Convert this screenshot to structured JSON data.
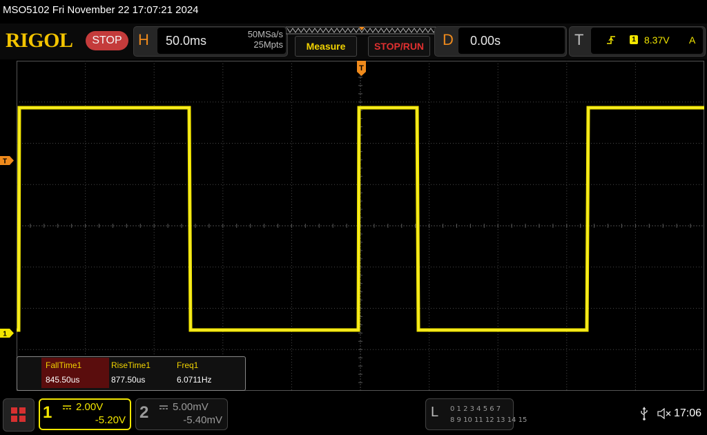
{
  "title_bar": {
    "text": "MSO5102  Fri November 22 17:07:21 2024"
  },
  "toolbar": {
    "logo": "RIGOL",
    "run_state": "STOP",
    "horizontal": {
      "letter": "H",
      "timebase": "50.0ms",
      "sample_rate": "50MSa/s",
      "memory_depth": "25Mpts"
    },
    "measure_label": "Measure",
    "stoprun_label": "STOP/RUN",
    "delay": {
      "letter": "D",
      "value": "0.00s"
    },
    "trigger": {
      "letter": "T",
      "edge_icon": "rising-edge-icon",
      "source": "1",
      "level": "8.37V",
      "mode": "A"
    }
  },
  "markers": {
    "trigger_position": "T",
    "trigger_level": "T",
    "channel1": "1"
  },
  "measurements": {
    "headers": [
      "FallTime1",
      "RiseTime1",
      "Freq1"
    ],
    "values": [
      "845.50us",
      "877.50us",
      "6.0711Hz"
    ]
  },
  "channels": [
    {
      "num": "1",
      "coupling_icon": "dc-coupling-icon",
      "scale": "2.00V",
      "offset": "-5.20V",
      "color": "#f2e600"
    },
    {
      "num": "2",
      "coupling_icon": "dc-coupling-icon",
      "scale": "5.00mV",
      "offset": "-5.40mV",
      "color": "#9a9a9a"
    }
  ],
  "logic_analyzer": {
    "letter": "L",
    "row1": "0 1 2 3   4 5 6 7",
    "row2": "8  9 10 11  12 13 14 15"
  },
  "status": {
    "usb_icon": "usb-icon",
    "volume_icon": "muted-speaker-icon",
    "time": "17:06"
  },
  "colors": {
    "trace": "#f2e600",
    "accent": "#ef8a1c",
    "stop": "#c43b3b"
  }
}
